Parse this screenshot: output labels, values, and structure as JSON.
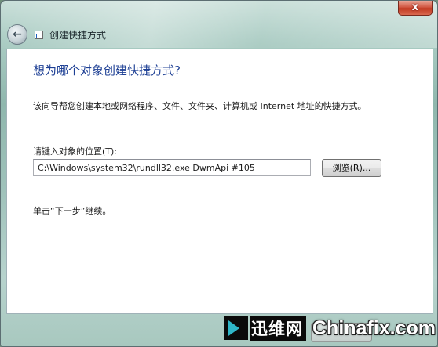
{
  "window": {
    "title": "创建快捷方式",
    "close_label": "x"
  },
  "main": {
    "heading": "想为哪个对象创建快捷方式?",
    "description": "该向导帮您创建本地或网络程序、文件、文件夹、计算机或 Internet 地址的快捷方式。",
    "location_label": "请键入对象的位置(T):",
    "location_value": "C:\\Windows\\system32\\rundll32.exe DwmApi #105",
    "browse_label": "浏览(R)...",
    "hint": "单击“下一步”继续。"
  },
  "watermark": {
    "cn": "迅维网",
    "en": "Chinafix.com"
  },
  "icons": {
    "back": "back-arrow-icon",
    "shortcut": "shortcut-icon",
    "close": "close-icon"
  },
  "colors": {
    "heading": "#1d3f94",
    "close_button": "#c23a22"
  }
}
